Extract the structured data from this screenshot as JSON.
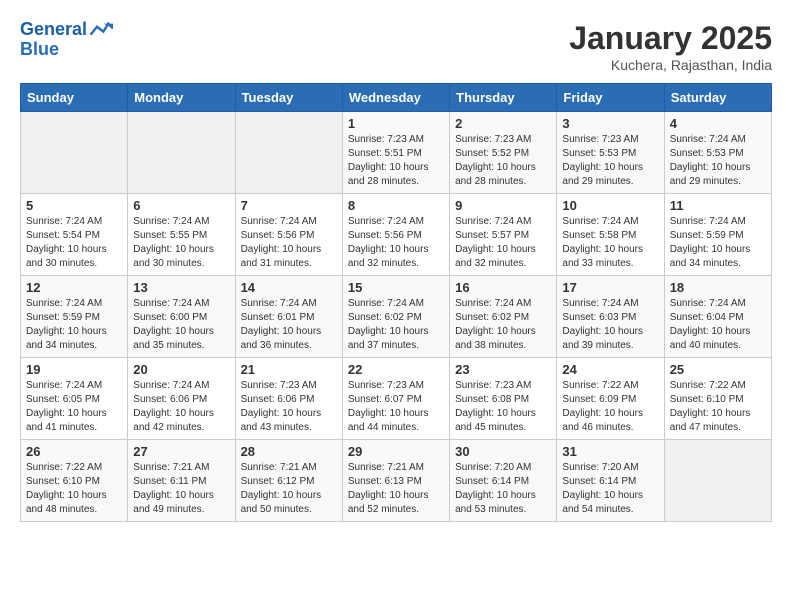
{
  "header": {
    "logo_line1": "General",
    "logo_line2": "Blue",
    "month_year": "January 2025",
    "location": "Kuchera, Rajasthan, India"
  },
  "weekdays": [
    "Sunday",
    "Monday",
    "Tuesday",
    "Wednesday",
    "Thursday",
    "Friday",
    "Saturday"
  ],
  "weeks": [
    [
      {
        "day": "",
        "sunrise": "",
        "sunset": "",
        "daylight": ""
      },
      {
        "day": "",
        "sunrise": "",
        "sunset": "",
        "daylight": ""
      },
      {
        "day": "",
        "sunrise": "",
        "sunset": "",
        "daylight": ""
      },
      {
        "day": "1",
        "sunrise": "Sunrise: 7:23 AM",
        "sunset": "Sunset: 5:51 PM",
        "daylight": "Daylight: 10 hours and 28 minutes."
      },
      {
        "day": "2",
        "sunrise": "Sunrise: 7:23 AM",
        "sunset": "Sunset: 5:52 PM",
        "daylight": "Daylight: 10 hours and 28 minutes."
      },
      {
        "day": "3",
        "sunrise": "Sunrise: 7:23 AM",
        "sunset": "Sunset: 5:53 PM",
        "daylight": "Daylight: 10 hours and 29 minutes."
      },
      {
        "day": "4",
        "sunrise": "Sunrise: 7:24 AM",
        "sunset": "Sunset: 5:53 PM",
        "daylight": "Daylight: 10 hours and 29 minutes."
      }
    ],
    [
      {
        "day": "5",
        "sunrise": "Sunrise: 7:24 AM",
        "sunset": "Sunset: 5:54 PM",
        "daylight": "Daylight: 10 hours and 30 minutes."
      },
      {
        "day": "6",
        "sunrise": "Sunrise: 7:24 AM",
        "sunset": "Sunset: 5:55 PM",
        "daylight": "Daylight: 10 hours and 30 minutes."
      },
      {
        "day": "7",
        "sunrise": "Sunrise: 7:24 AM",
        "sunset": "Sunset: 5:56 PM",
        "daylight": "Daylight: 10 hours and 31 minutes."
      },
      {
        "day": "8",
        "sunrise": "Sunrise: 7:24 AM",
        "sunset": "Sunset: 5:56 PM",
        "daylight": "Daylight: 10 hours and 32 minutes."
      },
      {
        "day": "9",
        "sunrise": "Sunrise: 7:24 AM",
        "sunset": "Sunset: 5:57 PM",
        "daylight": "Daylight: 10 hours and 32 minutes."
      },
      {
        "day": "10",
        "sunrise": "Sunrise: 7:24 AM",
        "sunset": "Sunset: 5:58 PM",
        "daylight": "Daylight: 10 hours and 33 minutes."
      },
      {
        "day": "11",
        "sunrise": "Sunrise: 7:24 AM",
        "sunset": "Sunset: 5:59 PM",
        "daylight": "Daylight: 10 hours and 34 minutes."
      }
    ],
    [
      {
        "day": "12",
        "sunrise": "Sunrise: 7:24 AM",
        "sunset": "Sunset: 5:59 PM",
        "daylight": "Daylight: 10 hours and 34 minutes."
      },
      {
        "day": "13",
        "sunrise": "Sunrise: 7:24 AM",
        "sunset": "Sunset: 6:00 PM",
        "daylight": "Daylight: 10 hours and 35 minutes."
      },
      {
        "day": "14",
        "sunrise": "Sunrise: 7:24 AM",
        "sunset": "Sunset: 6:01 PM",
        "daylight": "Daylight: 10 hours and 36 minutes."
      },
      {
        "day": "15",
        "sunrise": "Sunrise: 7:24 AM",
        "sunset": "Sunset: 6:02 PM",
        "daylight": "Daylight: 10 hours and 37 minutes."
      },
      {
        "day": "16",
        "sunrise": "Sunrise: 7:24 AM",
        "sunset": "Sunset: 6:02 PM",
        "daylight": "Daylight: 10 hours and 38 minutes."
      },
      {
        "day": "17",
        "sunrise": "Sunrise: 7:24 AM",
        "sunset": "Sunset: 6:03 PM",
        "daylight": "Daylight: 10 hours and 39 minutes."
      },
      {
        "day": "18",
        "sunrise": "Sunrise: 7:24 AM",
        "sunset": "Sunset: 6:04 PM",
        "daylight": "Daylight: 10 hours and 40 minutes."
      }
    ],
    [
      {
        "day": "19",
        "sunrise": "Sunrise: 7:24 AM",
        "sunset": "Sunset: 6:05 PM",
        "daylight": "Daylight: 10 hours and 41 minutes."
      },
      {
        "day": "20",
        "sunrise": "Sunrise: 7:24 AM",
        "sunset": "Sunset: 6:06 PM",
        "daylight": "Daylight: 10 hours and 42 minutes."
      },
      {
        "day": "21",
        "sunrise": "Sunrise: 7:23 AM",
        "sunset": "Sunset: 6:06 PM",
        "daylight": "Daylight: 10 hours and 43 minutes."
      },
      {
        "day": "22",
        "sunrise": "Sunrise: 7:23 AM",
        "sunset": "Sunset: 6:07 PM",
        "daylight": "Daylight: 10 hours and 44 minutes."
      },
      {
        "day": "23",
        "sunrise": "Sunrise: 7:23 AM",
        "sunset": "Sunset: 6:08 PM",
        "daylight": "Daylight: 10 hours and 45 minutes."
      },
      {
        "day": "24",
        "sunrise": "Sunrise: 7:22 AM",
        "sunset": "Sunset: 6:09 PM",
        "daylight": "Daylight: 10 hours and 46 minutes."
      },
      {
        "day": "25",
        "sunrise": "Sunrise: 7:22 AM",
        "sunset": "Sunset: 6:10 PM",
        "daylight": "Daylight: 10 hours and 47 minutes."
      }
    ],
    [
      {
        "day": "26",
        "sunrise": "Sunrise: 7:22 AM",
        "sunset": "Sunset: 6:10 PM",
        "daylight": "Daylight: 10 hours and 48 minutes."
      },
      {
        "day": "27",
        "sunrise": "Sunrise: 7:21 AM",
        "sunset": "Sunset: 6:11 PM",
        "daylight": "Daylight: 10 hours and 49 minutes."
      },
      {
        "day": "28",
        "sunrise": "Sunrise: 7:21 AM",
        "sunset": "Sunset: 6:12 PM",
        "daylight": "Daylight: 10 hours and 50 minutes."
      },
      {
        "day": "29",
        "sunrise": "Sunrise: 7:21 AM",
        "sunset": "Sunset: 6:13 PM",
        "daylight": "Daylight: 10 hours and 52 minutes."
      },
      {
        "day": "30",
        "sunrise": "Sunrise: 7:20 AM",
        "sunset": "Sunset: 6:14 PM",
        "daylight": "Daylight: 10 hours and 53 minutes."
      },
      {
        "day": "31",
        "sunrise": "Sunrise: 7:20 AM",
        "sunset": "Sunset: 6:14 PM",
        "daylight": "Daylight: 10 hours and 54 minutes."
      },
      {
        "day": "",
        "sunrise": "",
        "sunset": "",
        "daylight": ""
      }
    ]
  ]
}
